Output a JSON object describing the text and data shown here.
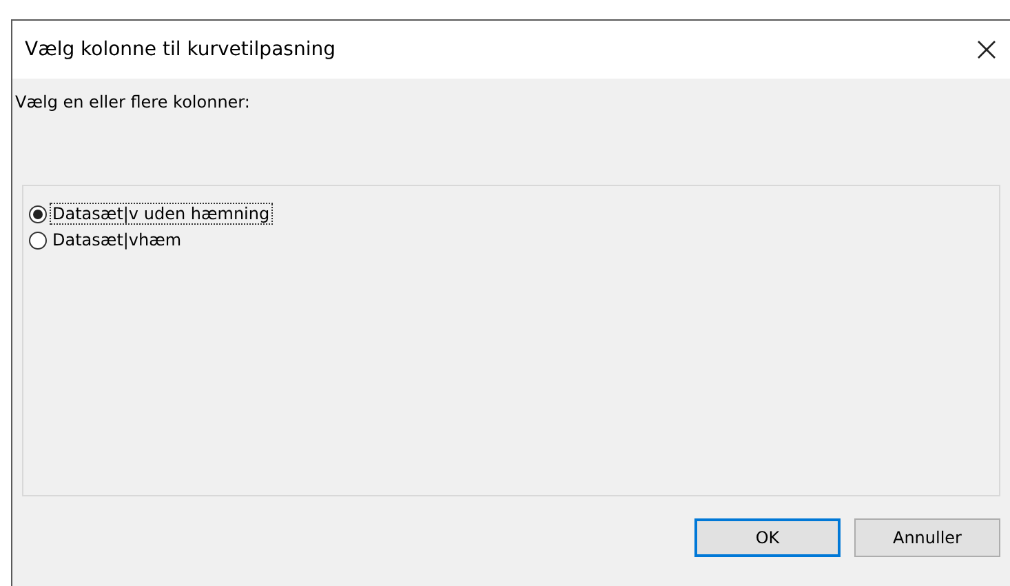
{
  "window": {
    "title": "Vælg kolonne til kurvetilpasning"
  },
  "prompt": "Vælg en eller flere kolonner:",
  "options": [
    {
      "label": "Datasæt|v uden hæmning",
      "selected": true
    },
    {
      "label": "Datasæt|vhæm",
      "selected": false
    }
  ],
  "buttons": [
    {
      "label": "OK",
      "default": true
    },
    {
      "label": "Annuller",
      "default": false
    }
  ]
}
